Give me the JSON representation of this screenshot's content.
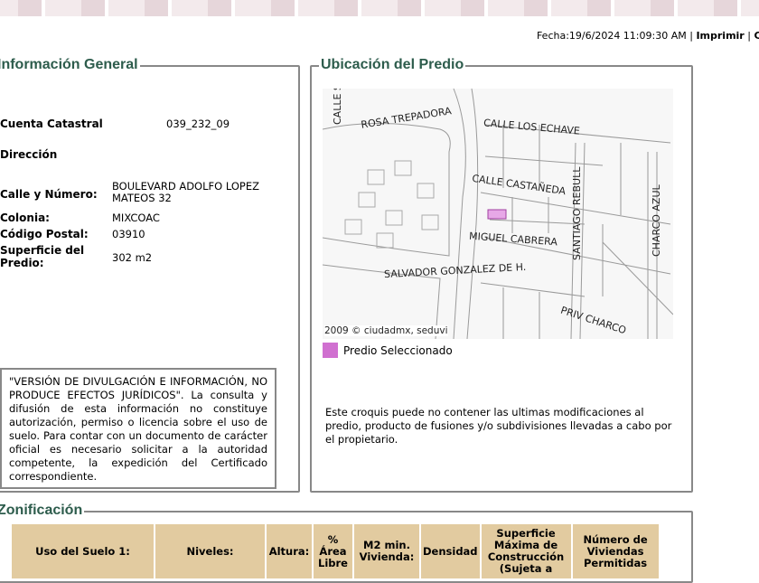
{
  "header": {
    "fecha": "Fecha:19/6/2024 11:09:30 AM",
    "sep": "|",
    "imprimir": "Imprimir",
    "cerrar": "Ce"
  },
  "info": {
    "title": "Información General",
    "cuenta_label": "Cuenta Catastral",
    "cuenta": "039_232_09",
    "direccion_label": "Dirección",
    "calle_label": "Calle y Número:",
    "calle": "BOULEVARD ADOLFO LOPEZ MATEOS 32",
    "colonia_label": "Colonia:",
    "colonia": "MIXCOAC",
    "cp_label": "Código Postal:",
    "cp": "03910",
    "sup_label": "Superficie del Predio:",
    "sup": "302 m2",
    "note": "\"VERSIÓN DE DIVULGACIÓN E INFORMACIÓN, NO PRODUCE EFECTOS JURÍDICOS\". La consulta y difusión de esta información no constituye autorización, permiso o licencia sobre el uso de suelo. Para contar con un documento de carácter oficial es necesario solicitar a la autoridad competente, la expedición del Certificado correspondiente."
  },
  "ubicacion": {
    "title": "Ubicación del Predio",
    "streets": [
      "CALLE SASSO",
      "ROSA TREPADORA",
      "CALLE LOS ECHAVE",
      "CALLE CASTAÑEDA",
      "SANTIAGO REBULL",
      "MIGUEL CABRERA",
      "CHARCO AZUL",
      "SALVADOR GONZALEZ DE H.",
      "PRIV CHARCO"
    ],
    "copyright": "2009 © ciudadmx, seduvi",
    "legend": "Predio Seleccionado",
    "legend_color": "#d070d0",
    "note": "Este croquis puede no contener las ultimas modificaciones al predio, producto de fusiones y/o subdivisiones llevadas a cabo por el propietario."
  },
  "zonificacion": {
    "title": "Zonificación",
    "columns": [
      "Uso del Suelo 1:",
      "Niveles:",
      "Altura:",
      "% Área Libre",
      "M2 min. Vivienda:",
      "Densidad",
      "Superficie Máxima de Construcción (Sujeta a",
      "Número de Viviendas Permitidas"
    ]
  }
}
